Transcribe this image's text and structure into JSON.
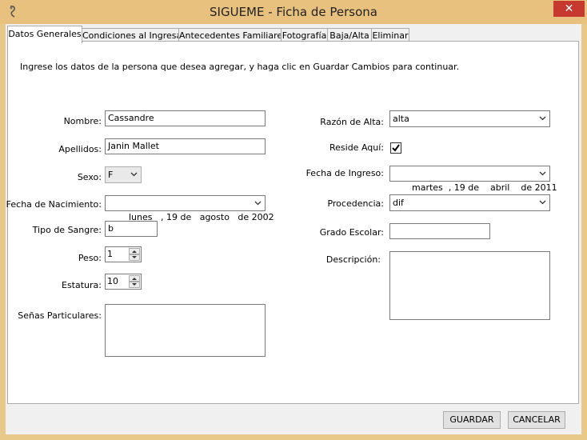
{
  "window": {
    "title": "SIGUEME - Ficha de Persona",
    "close_symbol": "✕",
    "app_icon": "app-logo-icon"
  },
  "tabs": [
    {
      "label": "Datos Generales"
    },
    {
      "label": "Condiciones al Ingresar"
    },
    {
      "label": "Antecedentes Familiares"
    },
    {
      "label": "Fotografía"
    },
    {
      "label": "Baja/Alta"
    },
    {
      "label": "Eliminar"
    }
  ],
  "form": {
    "intro": "Ingrese los datos de la persona que desea agregar, y haga clic en Guardar Cambios para continuar.",
    "nombre": {
      "label": "Nombre:",
      "value": "Cassandre"
    },
    "apellidos": {
      "label": "Apellidos:",
      "value": "Janin Mallet"
    },
    "sexo": {
      "label": "Sexo:",
      "value": "F"
    },
    "fecha_nacimiento": {
      "label": "Fecha de Nacimiento:",
      "value": "lunes   , 19 de   agosto   de 2002"
    },
    "tipo_sangre": {
      "label": "Tipo de Sangre:",
      "value": "b"
    },
    "peso": {
      "label": "Peso:",
      "value": "1"
    },
    "estatura": {
      "label": "Estatura:",
      "value": "10"
    },
    "senas": {
      "label": "Señas Particulares:",
      "value": ""
    },
    "razon_alta": {
      "label": "Razón de Alta:",
      "value": "alta"
    },
    "reside_aqui": {
      "label": "Reside Aquí:",
      "checked": true
    },
    "fecha_ingreso": {
      "label": "Fecha de Ingreso:",
      "value": "martes  , 19 de    abril    de 2011"
    },
    "procedencia": {
      "label": "Procedencia:",
      "value": "dif"
    },
    "grado_escolar": {
      "label": "Grado Escolar:",
      "value": ""
    },
    "descripcion": {
      "label": "Descripción:",
      "value": ""
    }
  },
  "buttons": {
    "guardar": "GUARDAR",
    "cancelar": "CANCELAR"
  }
}
